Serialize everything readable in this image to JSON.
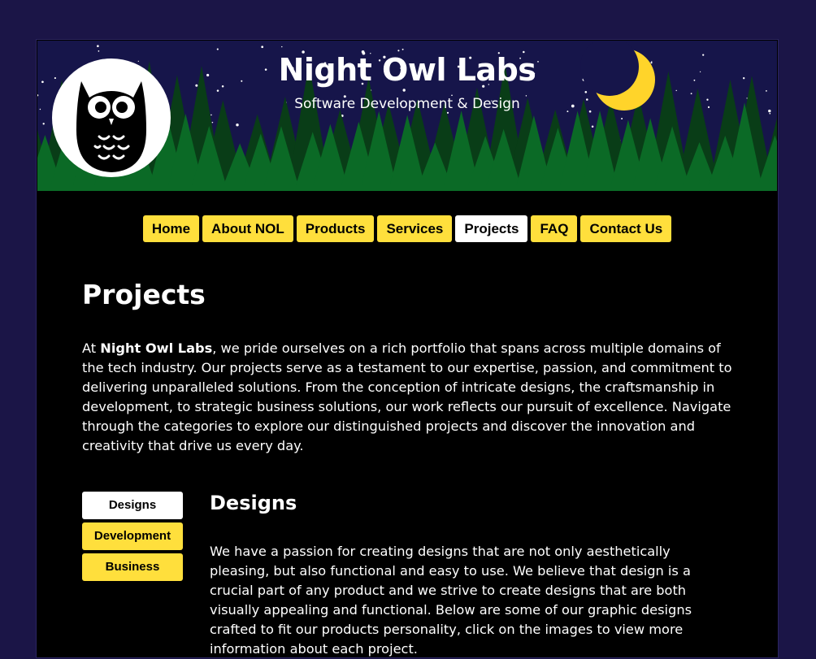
{
  "site": {
    "title": "Night Owl Labs",
    "tagline": "Software Development & Design"
  },
  "icons": {
    "logo": "owl-logo-icon",
    "moon": "crescent-moon-icon"
  },
  "colors": {
    "background": "#1b1547",
    "banner_sky": "#16154a",
    "accent_yellow": "#ffdf3c",
    "active_tab": "#ffffff",
    "trees": "#0a6b24",
    "moon": "#ffd42a"
  },
  "nav": {
    "items": [
      {
        "label": "Home",
        "active": false
      },
      {
        "label": "About NOL",
        "active": false
      },
      {
        "label": "Products",
        "active": false
      },
      {
        "label": "Services",
        "active": false
      },
      {
        "label": "Projects",
        "active": true
      },
      {
        "label": "FAQ",
        "active": false
      },
      {
        "label": "Contact Us",
        "active": false
      }
    ]
  },
  "main": {
    "title": "Projects",
    "intro_prefix": "At ",
    "intro_company": "Night Owl Labs",
    "intro_rest": ", we pride ourselves on a rich portfolio that spans across multiple domains of the tech industry. Our projects serve as a testament to our expertise, passion, and commitment to delivering unparalleled solutions. From the conception of intricate designs, the craftsmanship in development, to strategic business solutions, our work reflects our pursuit of excellence. Navigate through the categories to explore our distinguished projects and discover the innovation and creativity that drive us every day."
  },
  "categories": {
    "tabs": [
      {
        "label": "Designs",
        "active": true
      },
      {
        "label": "Development",
        "active": false
      },
      {
        "label": "Business",
        "active": false
      }
    ],
    "section_title": "Designs",
    "section_text": "We have a passion for creating designs that are not only aesthetically pleasing, but also functional and easy to use. We believe that design is a crucial part of any product and we strive to create designs that are both visually appealing and functional. Below are some of our graphic designs crafted to fit our products personality, click on the images to view more information about each project."
  }
}
